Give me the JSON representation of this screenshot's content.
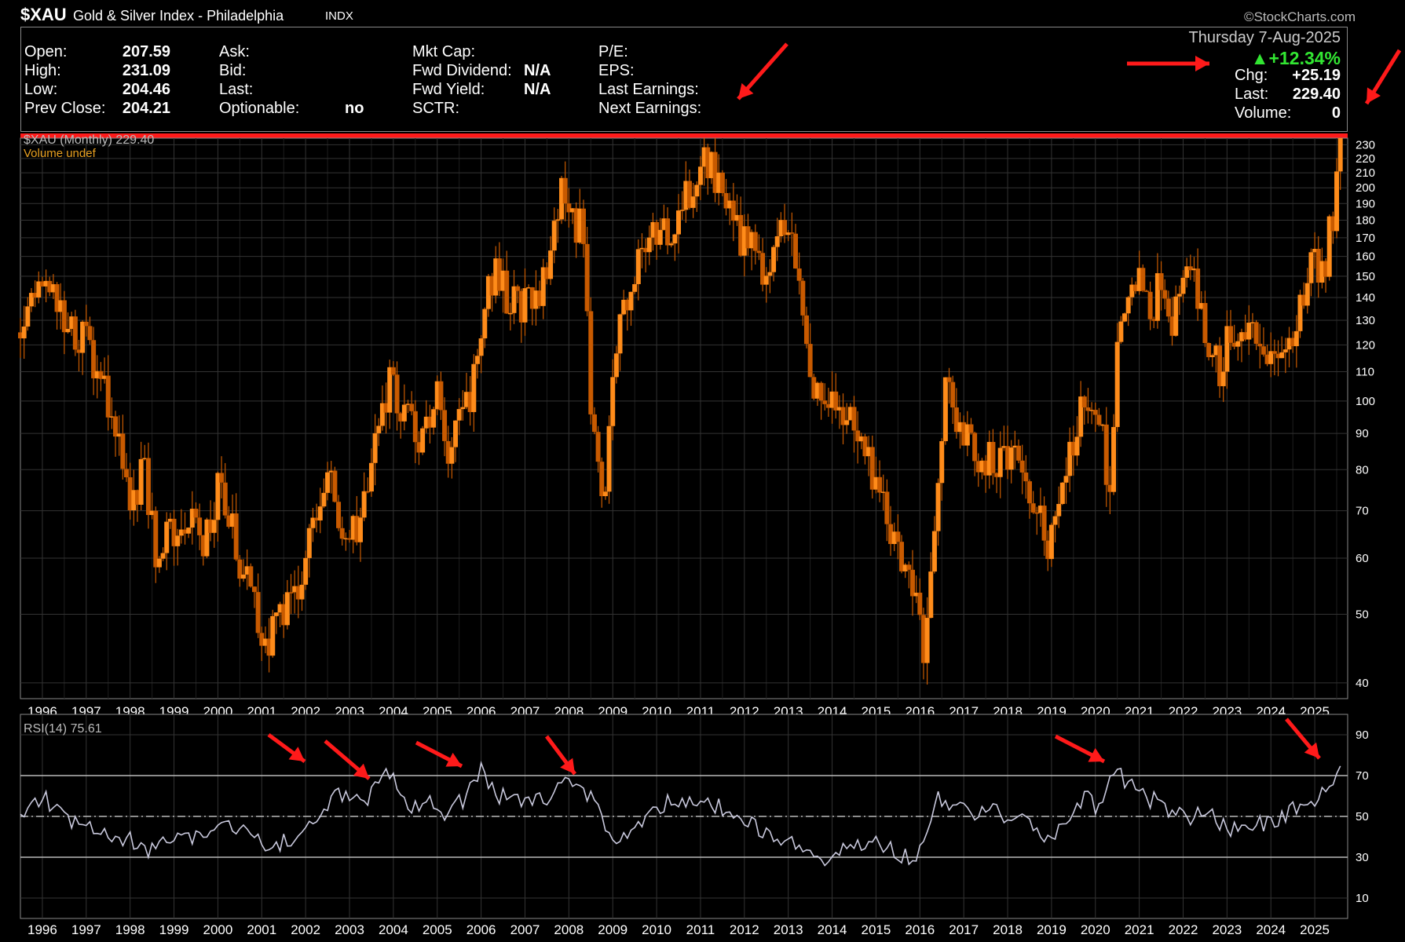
{
  "header": {
    "ticker": "$XAU",
    "name": "Gold & Silver Index - Philadelphia",
    "exchange": "INDX",
    "source": "©StockCharts.com"
  },
  "quote": {
    "open_label": "Open:",
    "open": "207.59",
    "high_label": "High:",
    "high": "231.09",
    "low_label": "Low:",
    "low": "204.46",
    "prev_close_label": "Prev Close:",
    "prev_close": "204.21",
    "ask_label": "Ask:",
    "bid_label": "Bid:",
    "last_label": "Last:",
    "optionable_label": "Optionable:",
    "optionable": "no",
    "mkt_cap_label": "Mkt Cap:",
    "fwd_dividend_label": "Fwd Dividend:",
    "fwd_dividend": "N/A",
    "fwd_yield_label": "Fwd Yield:",
    "fwd_yield": "N/A",
    "sctr_label": "SCTR:",
    "pe_label": "P/E:",
    "eps_label": "EPS:",
    "last_earnings_label": "Last Earnings:",
    "next_earnings_label": "Next Earnings:",
    "date": "Thursday  7-Aug-2025",
    "pct_change": "▲+12.34%",
    "chg_label": "Chg:",
    "chg": "+25.19",
    "last_price_label": "Last:",
    "last_price": "229.40",
    "volume_label": "Volume:",
    "volume": "0"
  },
  "colors": {
    "candle": "#ff8c1a",
    "candle_dark": "#c85a00",
    "rsi": "#c8c8dc",
    "annotation": "#ff1a1a",
    "up": "#32e632"
  },
  "chart_data": [
    {
      "type": "line",
      "title": "$XAU (Monthly) 229.40",
      "subtitle": "Volume undef",
      "y_scale": "log",
      "ylim": [
        38,
        235
      ],
      "y_ticks": [
        40,
        50,
        60,
        70,
        80,
        90,
        100,
        110,
        120,
        130,
        140,
        150,
        160,
        170,
        180,
        190,
        200,
        210,
        220,
        230
      ],
      "x_ticks": [
        "1996",
        "1997",
        "1998",
        "1999",
        "2000",
        "2001",
        "2002",
        "2003",
        "2004",
        "2005",
        "2006",
        "2007",
        "2008",
        "2009",
        "2010",
        "2011",
        "2012",
        "2013",
        "2014",
        "2015",
        "2016",
        "2017",
        "2018",
        "2019",
        "2020",
        "2021",
        "2022",
        "2023",
        "2024",
        "2025"
      ],
      "xlim": [
        1995.5,
        2025.75
      ],
      "grid": true,
      "series": [
        {
          "x": [
            1995.5,
            1996.1,
            1996.5,
            1997.0,
            1997.5,
            1997.8,
            1998.0,
            1998.3,
            1998.6,
            1998.9,
            1999.3,
            1999.7,
            2000.0,
            2000.5,
            2000.8,
            2001.1,
            2001.4,
            2001.8,
            2002.3,
            2002.5,
            2002.8,
            2003.2,
            2003.6,
            2003.9,
            2004.3,
            2004.6,
            2005.0,
            2005.3,
            2005.7,
            2006.0,
            2006.3,
            2006.6,
            2006.9,
            2007.2,
            2007.5,
            2007.8,
            2008.0,
            2008.3,
            2008.5,
            2008.8,
            2009.0,
            2009.3,
            2009.7,
            2010.0,
            2010.4,
            2010.8,
            2011.0,
            2011.3,
            2011.6,
            2011.9,
            2012.3,
            2012.6,
            2012.9,
            2013.2,
            2013.5,
            2013.8,
            2014.2,
            2014.6,
            2014.9,
            2015.2,
            2015.5,
            2015.9,
            2016.1,
            2016.3,
            2016.6,
            2016.9,
            2017.3,
            2017.7,
            2018.0,
            2018.4,
            2018.7,
            2018.9,
            2019.3,
            2019.6,
            2019.9,
            2020.2,
            2020.3,
            2020.6,
            2020.9,
            2021.2,
            2021.5,
            2021.8,
            2022.2,
            2022.5,
            2022.8,
            2023.1,
            2023.5,
            2023.9,
            2024.1,
            2024.4,
            2024.7,
            2024.9,
            2025.2,
            2025.5,
            2025.6
          ],
          "y": [
            125,
            150,
            130,
            120,
            100,
            85,
            70,
            80,
            60,
            65,
            70,
            62,
            75,
            60,
            52,
            45,
            48,
            55,
            70,
            80,
            62,
            68,
            85,
            105,
            95,
            85,
            100,
            85,
            98,
            130,
            150,
            140,
            138,
            140,
            150,
            195,
            185,
            175,
            100,
            70,
            110,
            140,
            165,
            175,
            170,
            205,
            220,
            210,
            200,
            170,
            160,
            150,
            185,
            150,
            110,
            100,
            95,
            90,
            80,
            70,
            60,
            55,
            45,
            60,
            105,
            90,
            85,
            82,
            85,
            78,
            70,
            62,
            75,
            95,
            100,
            85,
            70,
            140,
            150,
            135,
            145,
            130,
            155,
            125,
            110,
            125,
            130,
            120,
            110,
            115,
            140,
            155,
            150,
            200,
            229
          ]
        }
      ]
    },
    {
      "type": "line",
      "title": "RSI(14) 75.61",
      "ylim": [
        0,
        100
      ],
      "y_ticks": [
        10,
        30,
        50,
        70,
        90
      ],
      "reference_lines": [
        30,
        50,
        70
      ],
      "x_ticks": [
        "1996",
        "1997",
        "1998",
        "1999",
        "2000",
        "2001",
        "2002",
        "2003",
        "2004",
        "2005",
        "2006",
        "2007",
        "2008",
        "2009",
        "2010",
        "2011",
        "2012",
        "2013",
        "2014",
        "2015",
        "2016",
        "2017",
        "2018",
        "2019",
        "2020",
        "2021",
        "2022",
        "2023",
        "2024",
        "2025"
      ],
      "xlim": [
        1995.5,
        2025.75
      ],
      "grid": true,
      "series": [
        {
          "x": [
            1995.5,
            1996.0,
            1996.5,
            1997.0,
            1997.5,
            1998.0,
            1998.5,
            1998.8,
            1999.3,
            1999.8,
            2000.3,
            2000.8,
            2001.3,
            2001.8,
            2002.3,
            2002.6,
            2003.0,
            2003.5,
            2003.9,
            2004.3,
            2004.8,
            2005.2,
            2005.6,
            2006.0,
            2006.4,
            2006.8,
            2007.2,
            2007.6,
            2007.9,
            2008.3,
            2008.7,
            2009.0,
            2009.5,
            2010.0,
            2010.5,
            2011.0,
            2011.4,
            2011.8,
            2012.3,
            2012.8,
            2013.3,
            2013.8,
            2014.3,
            2014.8,
            2015.3,
            2015.8,
            2016.1,
            2016.4,
            2016.8,
            2017.2,
            2017.7,
            2018.2,
            2018.7,
            2019.0,
            2019.4,
            2019.8,
            2020.1,
            2020.3,
            2020.6,
            2020.9,
            2021.3,
            2021.8,
            2022.2,
            2022.6,
            2023.0,
            2023.5,
            2024.0,
            2024.4,
            2024.8,
            2025.2,
            2025.5,
            2025.6
          ],
          "y": [
            53,
            60,
            48,
            45,
            40,
            38,
            33,
            38,
            40,
            44,
            46,
            40,
            35,
            40,
            47,
            62,
            58,
            60,
            72,
            55,
            58,
            52,
            58,
            72,
            60,
            58,
            56,
            60,
            68,
            62,
            55,
            35,
            45,
            55,
            58,
            60,
            55,
            48,
            45,
            38,
            35,
            30,
            35,
            38,
            34,
            30,
            35,
            60,
            55,
            52,
            52,
            48,
            44,
            38,
            48,
            60,
            52,
            68,
            70,
            62,
            58,
            52,
            48,
            55,
            42,
            45,
            48,
            52,
            55,
            62,
            70,
            75.61
          ]
        }
      ]
    }
  ]
}
